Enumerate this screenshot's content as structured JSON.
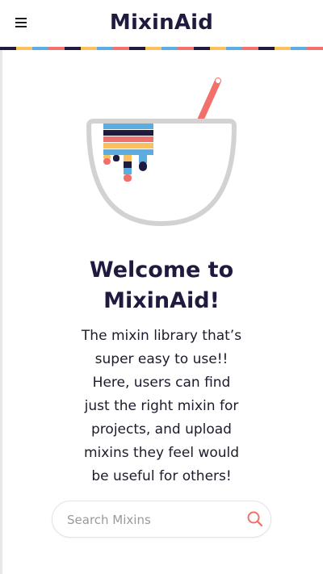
{
  "header": {
    "title": "MixinAid",
    "menu_icon": "hamburger-menu-icon"
  },
  "hero": {
    "illustration": "mixing-bowl-icon",
    "title_line1": "Welcome to",
    "title_line2": "MixinAid!",
    "desc_lines": [
      "The mixin library that’s",
      "super easy to use!!",
      "Here, users can find",
      "just the right mixin for",
      "projects, and upload",
      "mixins they feel would",
      "be useful for others!"
    ]
  },
  "search": {
    "placeholder": "Search Mixins",
    "icon": "search-icon"
  },
  "colors": {
    "navy": "#1f1b3f",
    "yellow": "#f8c15c",
    "blue": "#5baddf",
    "coral": "#f2706b"
  }
}
